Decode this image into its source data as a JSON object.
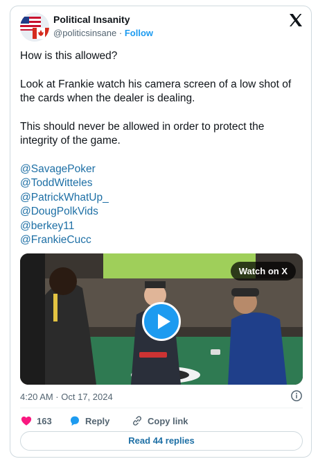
{
  "author": {
    "name": "Political Insanity",
    "handle": "@politicsinsane",
    "separator": "·",
    "follow_label": "Follow"
  },
  "tweet": {
    "paragraphs": [
      "How is this allowed?",
      "Look at Frankie watch his camera screen of a low shot of the cards when the dealer is dealing.",
      "This should never be allowed in order to protect the integrity of the game."
    ],
    "mentions": [
      "@SavagePoker",
      "@ToddWitteles",
      "@PatrickWhatUp_",
      "@DougPolkVids",
      "@berkey11",
      "@FrankieCucc"
    ]
  },
  "media": {
    "watch_label": "Watch on X"
  },
  "meta": {
    "timestamp": "4:20 AM · Oct 17, 2024"
  },
  "actions": {
    "likes_count": "163",
    "reply_label": "Reply",
    "copy_link_label": "Copy link"
  },
  "read_replies_label": "Read 44 replies",
  "icons": {
    "x_logo": "x-logo-icon",
    "heart": "heart-icon",
    "reply": "reply-icon",
    "link": "link-icon",
    "info": "info-icon",
    "play": "play-icon"
  },
  "colors": {
    "link": "#1d6fa5",
    "accent": "#1d9bf0",
    "like": "#f91880",
    "muted": "#536471"
  }
}
